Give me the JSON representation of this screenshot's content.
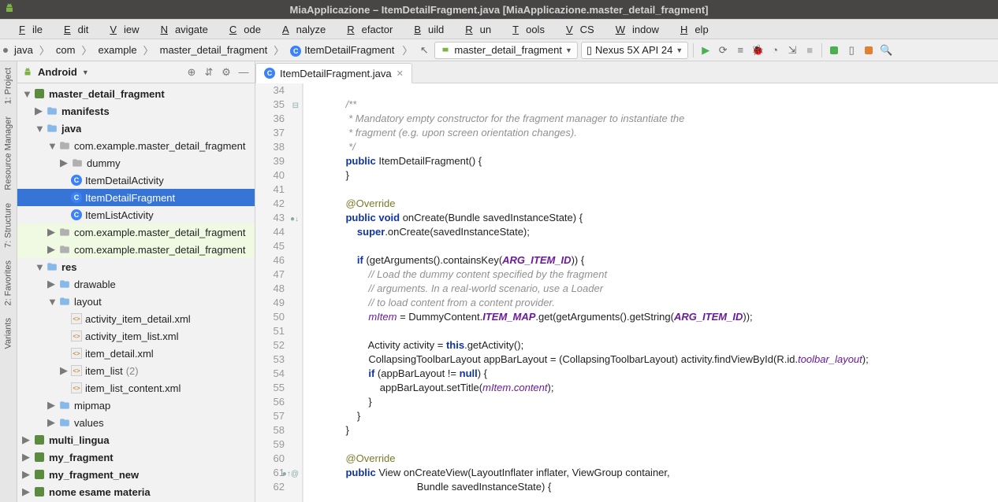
{
  "window": {
    "title": "MiaApplicazione – ItemDetailFragment.java [MiaApplicazione.master_detail_fragment]"
  },
  "menu": [
    "File",
    "Edit",
    "View",
    "Navigate",
    "Code",
    "Analyze",
    "Refactor",
    "Build",
    "Run",
    "Tools",
    "VCS",
    "Window",
    "Help"
  ],
  "breadcrumbs": [
    "java",
    "com",
    "example",
    "master_detail_fragment",
    "ItemDetailFragment"
  ],
  "run_config": {
    "module": "master_detail_fragment",
    "device": "Nexus 5X API 24"
  },
  "project_view": {
    "dropdown": "Android",
    "tree": [
      {
        "d": 0,
        "kind": "module",
        "label": "master_detail_fragment",
        "bold": true,
        "exp": true
      },
      {
        "d": 1,
        "kind": "folder",
        "label": "manifests",
        "bold": true,
        "exp": false,
        "caret": "closed"
      },
      {
        "d": 1,
        "kind": "folder",
        "label": "java",
        "bold": true,
        "exp": true
      },
      {
        "d": 2,
        "kind": "pkg",
        "label": "com.example.master_detail_fragment",
        "exp": true,
        "caret": "open"
      },
      {
        "d": 3,
        "kind": "pkg",
        "label": "dummy",
        "caret": "closed"
      },
      {
        "d": 3,
        "kind": "class",
        "label": "ItemDetailActivity"
      },
      {
        "d": 3,
        "kind": "class",
        "label": "ItemDetailFragment",
        "sel": true
      },
      {
        "d": 3,
        "kind": "class",
        "label": "ItemListActivity"
      },
      {
        "d": 2,
        "kind": "pkg",
        "label": "com.example.master_detail_fragment",
        "caret": "closed",
        "hl": true
      },
      {
        "d": 2,
        "kind": "pkg",
        "label": "com.example.master_detail_fragment",
        "caret": "closed",
        "hl": true
      },
      {
        "d": 1,
        "kind": "folder",
        "label": "res",
        "bold": true,
        "exp": true,
        "caret": "open"
      },
      {
        "d": 2,
        "kind": "folder",
        "label": "drawable",
        "caret": "closed"
      },
      {
        "d": 2,
        "kind": "folder",
        "label": "layout",
        "exp": true,
        "caret": "open"
      },
      {
        "d": 3,
        "kind": "xml",
        "label": "activity_item_detail.xml"
      },
      {
        "d": 3,
        "kind": "xml",
        "label": "activity_item_list.xml"
      },
      {
        "d": 3,
        "kind": "xml",
        "label": "item_detail.xml"
      },
      {
        "d": 3,
        "kind": "xml",
        "label": "item_list",
        "suffix": "(2)",
        "caret": "closed"
      },
      {
        "d": 3,
        "kind": "xml",
        "label": "item_list_content.xml"
      },
      {
        "d": 2,
        "kind": "folder",
        "label": "mipmap",
        "caret": "closed"
      },
      {
        "d": 2,
        "kind": "folder",
        "label": "values",
        "caret": "closed"
      },
      {
        "d": 0,
        "kind": "module",
        "label": "multi_lingua",
        "bold": true,
        "caret": "closed"
      },
      {
        "d": 0,
        "kind": "module",
        "label": "my_fragment",
        "bold": true,
        "caret": "closed"
      },
      {
        "d": 0,
        "kind": "module",
        "label": "my_fragment_new",
        "bold": true,
        "caret": "closed"
      },
      {
        "d": 0,
        "kind": "module",
        "label": "nome esame materia",
        "bold": true,
        "caret": "closed"
      }
    ]
  },
  "editor": {
    "tab": "ItemDetailFragment.java",
    "first_line": 34,
    "marks": {
      "35": "⊟",
      "43": "●↓",
      "61": "●↑@"
    },
    "lines": [
      {
        "t": ""
      },
      {
        "t": "/**",
        "cls": "cmt",
        "i": 1
      },
      {
        "t": " * Mandatory empty constructor for the fragment manager to instantiate the",
        "cls": "cmt",
        "i": 1
      },
      {
        "t": " * fragment (e.g. upon screen orientation changes).",
        "cls": "cmt",
        "i": 1
      },
      {
        "t": " */",
        "cls": "cmt",
        "i": 1
      },
      {
        "h": "<span class='kw'>public</span> ItemDetailFragment() {",
        "i": 1
      },
      {
        "t": "}",
        "i": 1
      },
      {
        "t": "",
        "i": 1
      },
      {
        "h": "<span class='ann'>@Override</span>",
        "i": 1
      },
      {
        "h": "<span class='kw'>public void</span> onCreate(Bundle savedInstanceState) {",
        "i": 1
      },
      {
        "h": "<span class='kw'>super</span>.onCreate(savedInstanceState);",
        "i": 2
      },
      {
        "t": "",
        "i": 2
      },
      {
        "h": "<span class='kw'>if</span> (getArguments().containsKey(<span class='stat'>ARG_ITEM_ID</span>)) {",
        "i": 2
      },
      {
        "h": "<span class='cmt'>// Load the dummy content specified by the fragment</span>",
        "i": 3
      },
      {
        "h": "<span class='cmt'>// arguments. In a real-world scenario, use a Loader</span>",
        "i": 3
      },
      {
        "h": "<span class='cmt'>// to load content from a content provider.</span>",
        "i": 3
      },
      {
        "h": "<span class='fld'>mItem</span> = DummyContent.<span class='stat'>ITEM_MAP</span>.get(getArguments().getString(<span class='stat'>ARG_ITEM_ID</span>));",
        "i": 3
      },
      {
        "t": "",
        "i": 3
      },
      {
        "h": "Activity activity = <span class='kw'>this</span>.getActivity();",
        "i": 3
      },
      {
        "h": "CollapsingToolbarLayout appBarLayout = (CollapsingToolbarLayout) activity.findViewById(R.id.<span class='fld'>toolbar_layout</span>);",
        "i": 3
      },
      {
        "h": "<span class='kw'>if</span> (appBarLayout != <span class='kw'>null</span>) {",
        "i": 3
      },
      {
        "h": "appBarLayout.setTitle(<span class='fld'>mItem</span>.<span class='fld'>content</span>);",
        "i": 4
      },
      {
        "t": "}",
        "i": 3
      },
      {
        "t": "}",
        "i": 2
      },
      {
        "t": "}",
        "i": 1
      },
      {
        "t": "",
        "i": 1
      },
      {
        "h": "<span class='ann'>@Override</span>",
        "i": 1
      },
      {
        "h": "<span class='kw'>public</span> View onCreateView(LayoutInflater inflater, ViewGroup container,",
        "i": 1
      },
      {
        "h": "                         Bundle savedInstanceState) {",
        "i": 1
      }
    ]
  },
  "vertical_tabs": [
    "1: Project",
    "Resource Manager",
    "7: Structure",
    "2: Favorites",
    "Variants"
  ]
}
